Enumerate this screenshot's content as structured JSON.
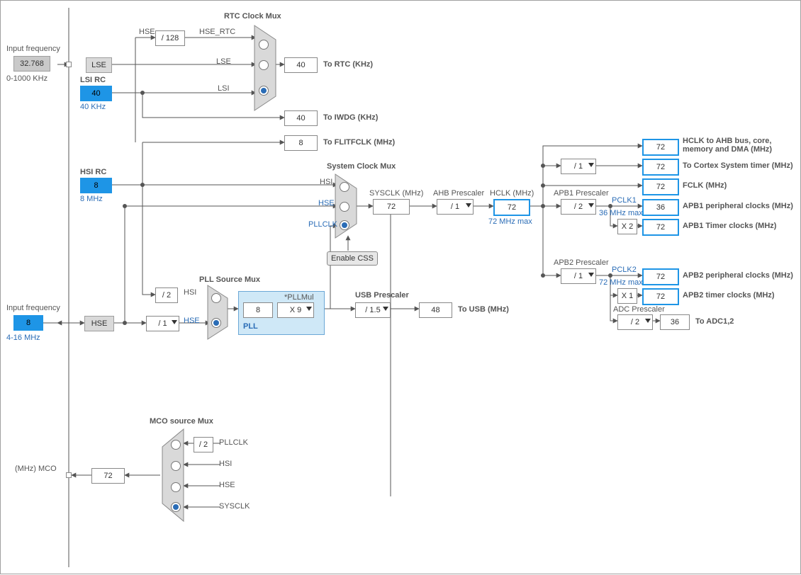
{
  "titles": {
    "rtc_mux": "RTC Clock Mux",
    "pll_src_mux": "PLL Source Mux",
    "sys_mux": "System Clock Mux",
    "mco_mux": "MCO source Mux",
    "pll_block": "PLL",
    "pllmul": "*PLLMul",
    "usb_presc": "USB Prescaler",
    "ahb_presc": "AHB Prescaler",
    "apb1_presc": "APB1 Prescaler",
    "apb2_presc": "APB2 Prescaler",
    "adc_presc": "ADC Prescaler"
  },
  "sources": {
    "input_freq_top_label": "Input frequency",
    "input_freq_top_val": "32.768",
    "input_freq_top_range": "0-1000 KHz",
    "lse": "LSE",
    "lsi_rc": "LSI RC",
    "lsi_val": "40",
    "lsi_unit": "40 KHz",
    "hsi_rc": "HSI RC",
    "hsi_val": "8",
    "hsi_unit": "8 MHz",
    "input_freq_bot_label": "Input frequency",
    "input_freq_bot_val": "8",
    "input_freq_bot_range": "4-16 MHz",
    "hse": "HSE"
  },
  "rtc": {
    "div128": "/ 128",
    "hse_rtc": "HSE_RTC",
    "lse_in": "LSE",
    "lsi_in": "LSI",
    "out_val": "40",
    "out_label": "To RTC (KHz)"
  },
  "iwdg": {
    "val": "40",
    "label": "To IWDG (KHz)"
  },
  "flitfclk": {
    "val": "8",
    "label": "To FLITFCLK (MHz)"
  },
  "hse_presc": "/ 1",
  "pll_src": {
    "div2": "/ 2",
    "hsi_label": "HSI",
    "hse_label": "HSE"
  },
  "pll": {
    "val": "8",
    "mul": "X 9"
  },
  "usb": {
    "presc": "/ 1.5",
    "val": "48",
    "label": "To USB (MHz)"
  },
  "sys": {
    "hsi": "HSI",
    "hse": "HSE",
    "pllclk": "PLLCLK",
    "sysclk_label": "SYSCLK (MHz)",
    "sysclk_val": "72",
    "enable_css": "Enable CSS"
  },
  "ahb": {
    "presc": "/ 1",
    "hclk_label": "HCLK (MHz)",
    "hclk_val": "72",
    "hclk_max": "72 MHz max"
  },
  "right": {
    "hclk_val": "72",
    "hclk_label": "HCLK to AHB bus, core, memory and DMA (MHz)",
    "cortex_div": "/ 1",
    "cortex_val": "72",
    "cortex_label": "To Cortex System timer (MHz)",
    "fclk_val": "72",
    "fclk_label": "FCLK (MHz)",
    "apb1_presc": "/ 2",
    "pclk1_label": "PCLK1",
    "pclk1_max": "36 MHz max",
    "apb1_periph_val": "36",
    "apb1_periph_label": "APB1 peripheral clocks (MHz)",
    "apb1_tim_mul": "X 2",
    "apb1_tim_val": "72",
    "apb1_tim_label": "APB1 Timer clocks (MHz)",
    "apb2_presc": "/ 1",
    "pclk2_label": "PCLK2",
    "pclk2_max": "72 MHz max",
    "apb2_periph_val": "72",
    "apb2_periph_label": "APB2 peripheral clocks (MHz)",
    "apb2_tim_mul": "X 1",
    "apb2_tim_val": "72",
    "apb2_tim_label": "APB2 timer clocks (MHz)",
    "adc_presc": "/ 2",
    "adc_val": "36",
    "adc_label": "To ADC1,2"
  },
  "mco": {
    "div2": "/ 2",
    "pllclk": "PLLCLK",
    "hsi": "HSI",
    "hse": "HSE",
    "sysclk": "SYSCLK",
    "out_val": "72",
    "out_label": "(MHz) MCO"
  },
  "sig": {
    "hse_top": "HSE"
  }
}
